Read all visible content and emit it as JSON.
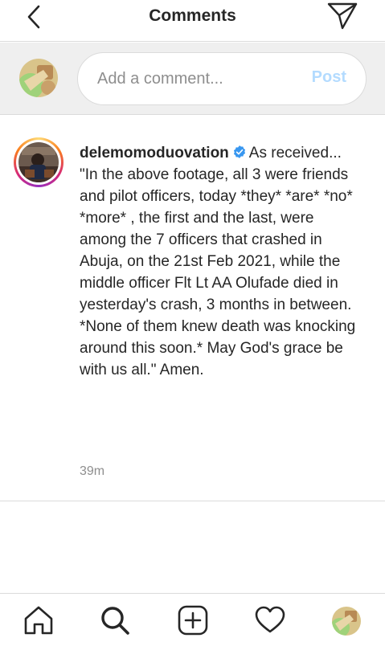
{
  "header": {
    "title": "Comments",
    "back_icon": "chevron-left-icon",
    "send_icon": "paper-plane-icon"
  },
  "composer": {
    "placeholder": "Add a comment...",
    "post_label": "Post",
    "post_color": "#b3dbff"
  },
  "comment": {
    "username": "delemomoduovation",
    "verified_icon": "verified-badge-icon",
    "text": "As received...\n\"In the above footage, all 3 were friends and pilot officers, today *they* *are* *no* *more* , the first and the last, were among the 7 officers that crashed in Abuja, on the 21st Feb 2021, while the middle officer Flt Lt AA Olufade died in yesterday's crash, 3 months in between.\n*None of them knew death was knocking around this soon.* May God's grace be with us all.\" Amen.",
    "timestamp": "39m"
  },
  "tabbar": {
    "items": [
      "home-icon",
      "search-icon",
      "create-icon",
      "heart-icon",
      "profile-avatar"
    ]
  },
  "colors": {
    "text": "#262626",
    "secondary": "#8e8e8e",
    "divider": "#dbdbdb",
    "verified": "#3897f0"
  }
}
